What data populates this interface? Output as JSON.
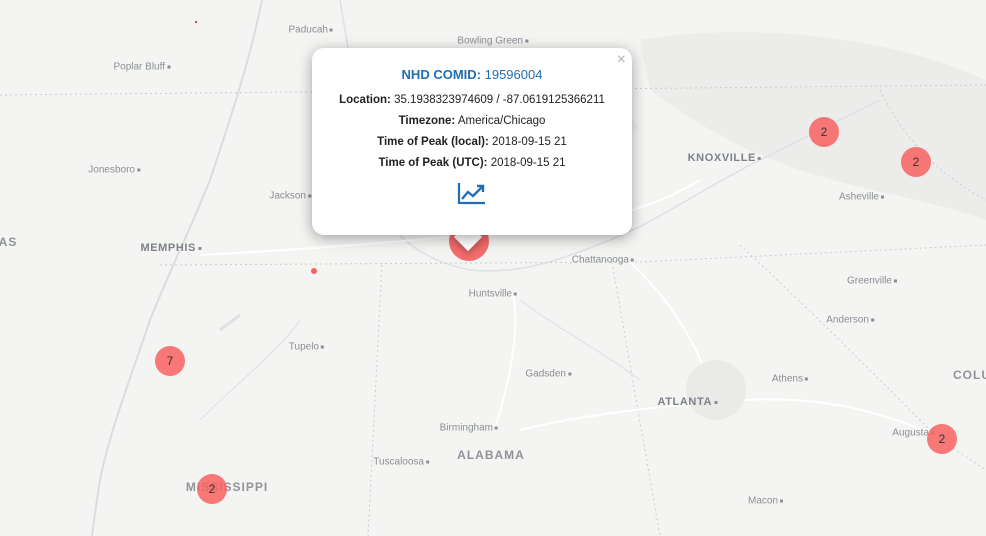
{
  "map": {
    "state_labels": [
      "MISSISSIPPI",
      "ALABAMA",
      "AS",
      "COLU"
    ],
    "cities": {
      "paducah": "Paducah",
      "bowling_green": "Bowling Green",
      "poplar_bluff": "Poplar Bluff",
      "jonesboro": "Jonesboro",
      "jackson": "Jackson",
      "memphis": "MEMPHIS",
      "knoxville": "KNOXVILLE",
      "asheville": "Asheville",
      "chattanooga": "Chattanooga",
      "huntsville": "Huntsville",
      "greenville": "Greenville",
      "anderson": "Anderson",
      "tupelo": "Tupelo",
      "gadsden": "Gadsden",
      "athens": "Athens",
      "atlanta": "ATLANTA",
      "birmingham": "Birmingham",
      "augusta": "Augusta",
      "tuscaloosa": "Tuscaloosa",
      "macon": "Macon"
    }
  },
  "clusters": [
    "2",
    "2",
    "7",
    "2",
    "2"
  ],
  "marker_color": "#f86262",
  "accent_color": "#1f6fb2",
  "popup": {
    "close": "×",
    "title_label": "NHD COMID:",
    "title_value": "19596004",
    "location_label": "Location:",
    "location_value": "35.1938323974609 / -87.0619125366211",
    "timezone_label": "Timezone:",
    "timezone_value": "America/Chicago",
    "peak_local_label": "Time of Peak (local):",
    "peak_local_value": "2018-09-15 21",
    "peak_utc_label": "Time of Peak (UTC):",
    "peak_utc_value": "2018-09-15 21",
    "chart_icon": "line-chart-icon"
  }
}
